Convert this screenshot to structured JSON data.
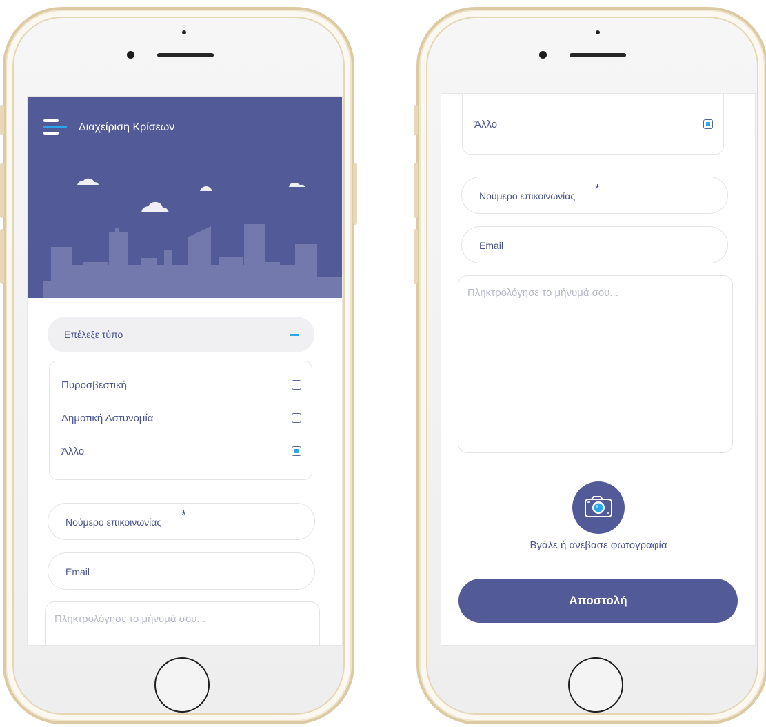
{
  "app": {
    "header_title": "Διαχείριση Κρίσεων"
  },
  "type_select": {
    "label": "Επέλεξε τύπο",
    "options": [
      {
        "label": "Πυροσβεστική",
        "checked": false
      },
      {
        "label": "Δημοτική Αστυνομία",
        "checked": false
      },
      {
        "label": "Άλλο",
        "checked": true
      }
    ]
  },
  "form": {
    "phone_label": "Νούμερο επικοινωνίας",
    "required_mark": "*",
    "email_label": "Email",
    "message_placeholder": "Πληκτρολόγησε το μήνυμά σου..."
  },
  "photo": {
    "caption": "Βγάλε ή ανέβασε φωτογραφία",
    "icon": "camera-icon"
  },
  "submit": {
    "label": "Αποστολή"
  },
  "colors": {
    "primary": "#525b98",
    "accent": "#2aa7e8",
    "text": "#4b5490",
    "placeholder": "#b6b8c8",
    "frame_gold": "#dccaa3"
  }
}
